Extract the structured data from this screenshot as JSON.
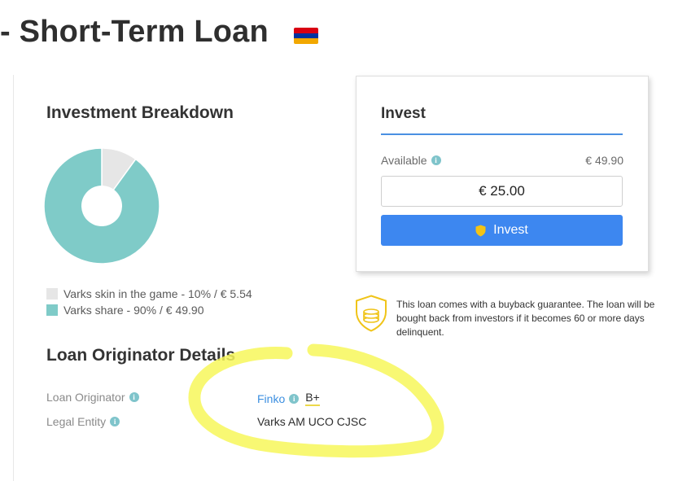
{
  "header": {
    "title": "- Short-Term Loan",
    "flag_colors": [
      "#d90012",
      "#0033a0",
      "#f2a800"
    ]
  },
  "breakdown": {
    "title": "Investment Breakdown",
    "legend": [
      {
        "label": "Varks skin in the game - 10% / € 5.54",
        "color": "#e6e6e6"
      },
      {
        "label": "Varks share - 90% / € 49.90",
        "color": "#7fcbc8"
      }
    ]
  },
  "chart_data": {
    "type": "pie",
    "categories": [
      "Varks skin in the game",
      "Varks share"
    ],
    "values": [
      10,
      90
    ],
    "colors": [
      "#e6e6e6",
      "#7fcbc8"
    ]
  },
  "invest": {
    "title": "Invest",
    "available_label": "Available",
    "available_value": "€ 49.90",
    "amount_value": "€ 25.00",
    "button_label": "Invest",
    "accent_color": "#3d87f0"
  },
  "buyback": {
    "text": "This loan comes with a buyback guarantee. The loan will be bought back from investors if it becomes 60 or more days delinquent."
  },
  "originator": {
    "title": "Loan Originator Details",
    "rows": [
      {
        "label": "Loan Originator",
        "value": "Finko",
        "grade": "B+"
      },
      {
        "label": "Legal Entity",
        "value": "Varks AM UCO CJSC"
      }
    ]
  },
  "annotation": {
    "color": "#f7f75a"
  }
}
